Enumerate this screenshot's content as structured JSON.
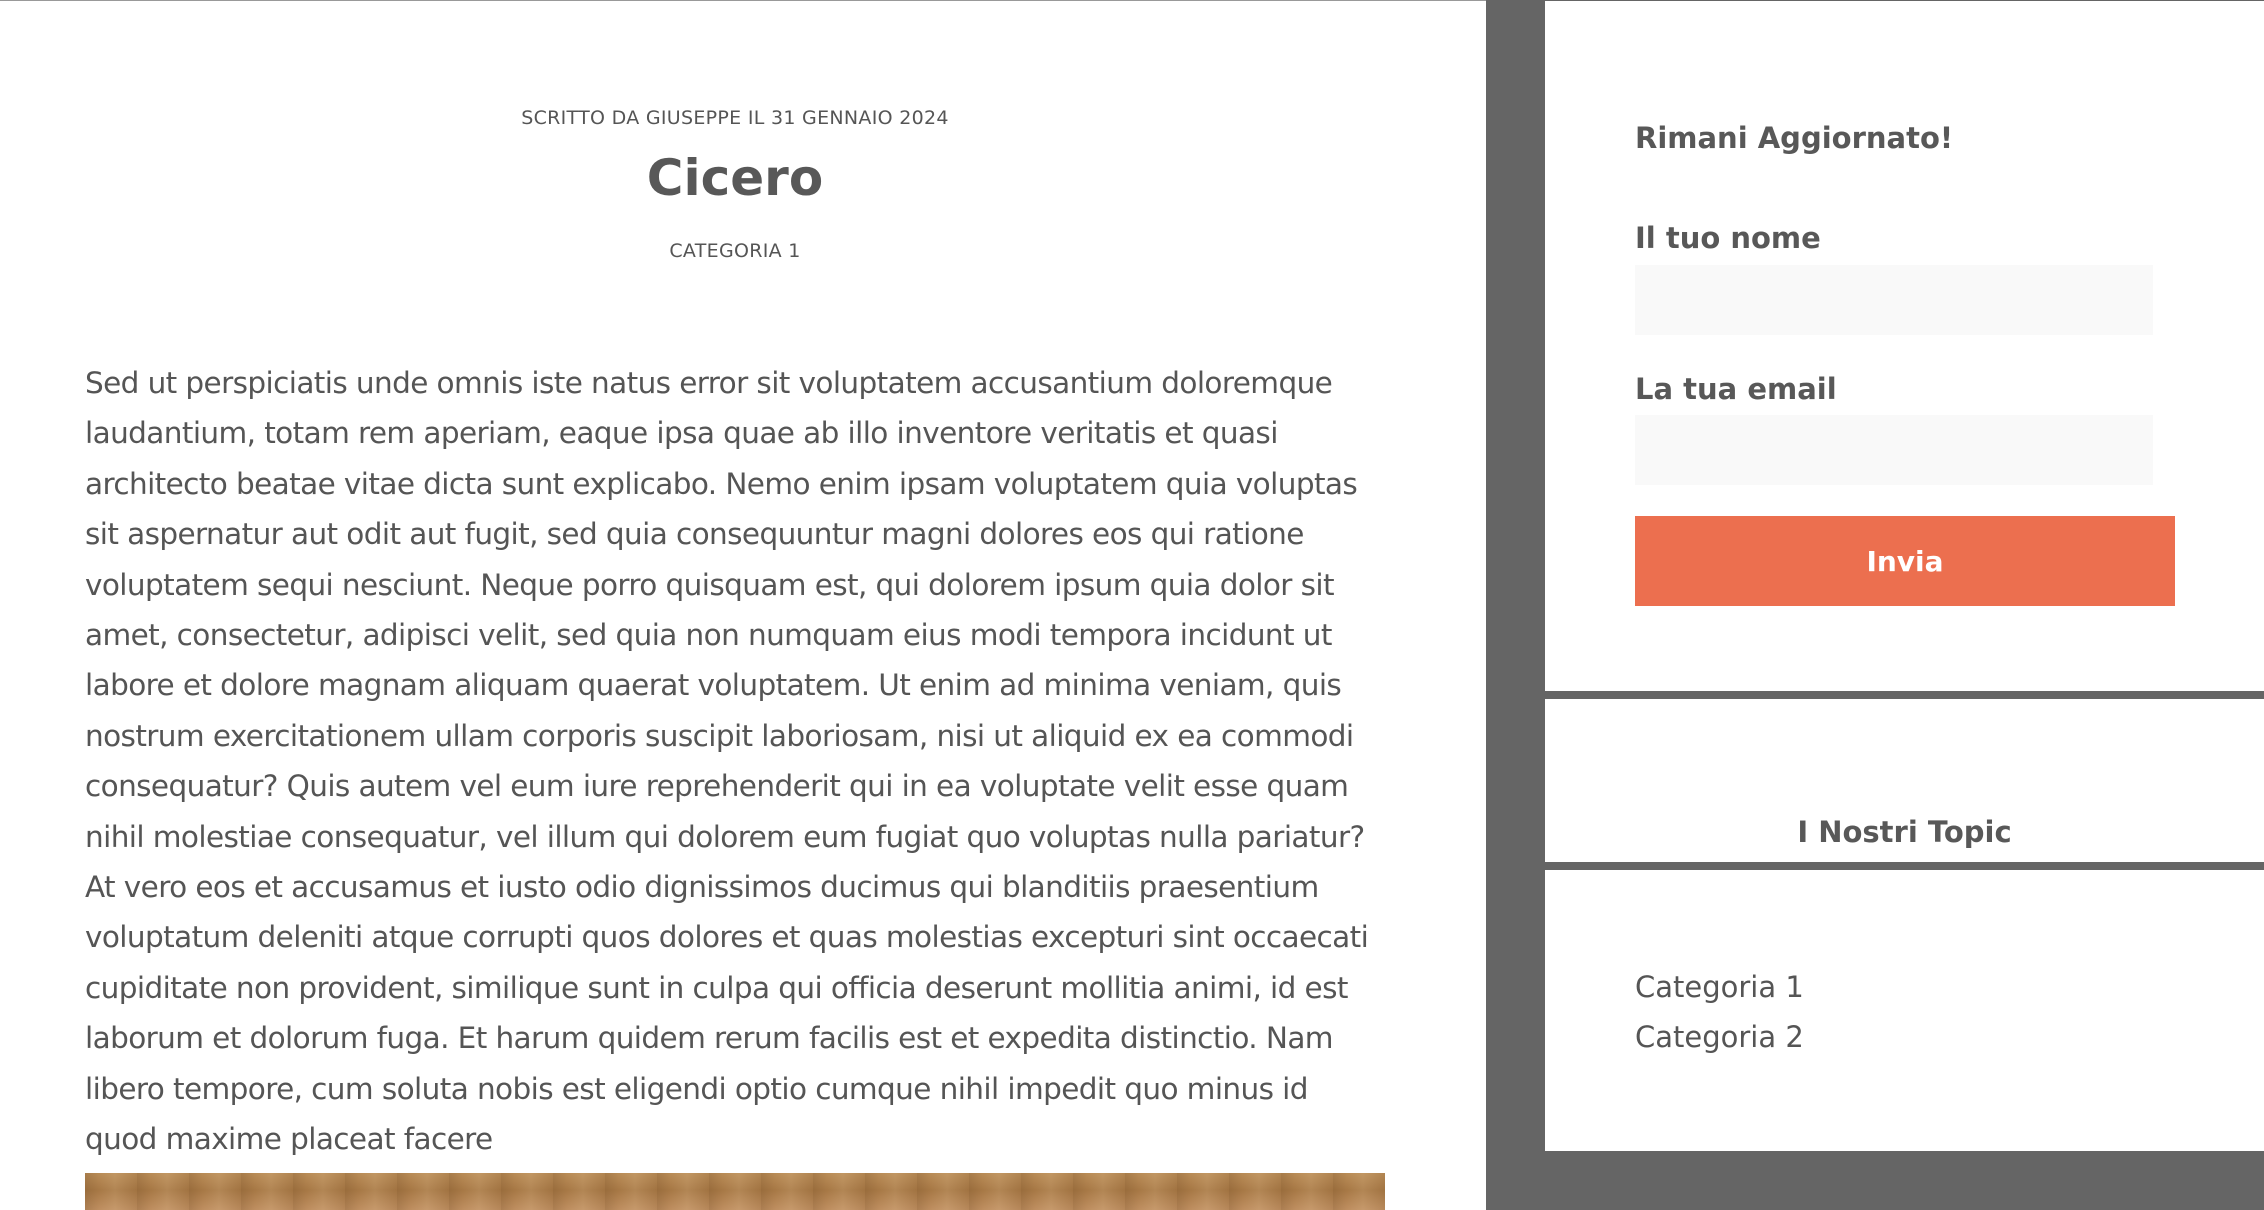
{
  "article": {
    "meta": "SCRITTO DA GIUSEPPE IL 31 GENNAIO 2024",
    "title": "Cicero",
    "category": "CATEGORIA 1",
    "body": "Sed ut perspiciatis unde omnis iste natus error sit voluptatem accusantium doloremque laudantium, totam rem aperiam, eaque ipsa quae ab illo inventore veritatis et quasi architecto beatae vitae dicta sunt explicabo. Nemo enim ipsam voluptatem quia voluptas sit aspernatur aut odit aut fugit, sed quia consequuntur magni dolores eos qui ratione voluptatem sequi nesciunt. Neque porro quisquam est, qui dolorem ipsum quia dolor sit amet, consectetur, adipisci velit, sed quia non numquam eius modi tempora incidunt ut labore et dolore magnam aliquam quaerat voluptatem. Ut enim ad minima veniam, quis nostrum exercitationem ullam corporis suscipit laboriosam, nisi ut aliquid ex ea commodi consequatur? Quis autem vel eum iure reprehenderit qui in ea voluptate velit esse quam nihil molestiae consequatur, vel illum qui dolorem eum fugiat quo voluptas nulla pariatur? At vero eos et accusamus et iusto odio dignissimos ducimus qui blanditiis praesentium voluptatum deleniti atque corrupti quos dolores et quas molestias excepturi sint occaecati cupiditate non provident, similique sunt in culpa qui officia deserunt mollitia animi, id est laborum et dolorum fuga. Et harum quidem rerum facilis est et expedita distinctio. Nam libero tempore, cum soluta nobis est eligendi optio cumque nihil impedit quo minus id quod maxime placeat facere"
  },
  "newsletter": {
    "heading": "Rimani Aggiornato!",
    "name_label": "Il tuo nome",
    "name_value": "",
    "email_label": "La tua email",
    "email_value": "",
    "submit_label": "Invia"
  },
  "topics": {
    "heading": "I Nostri Topic",
    "items": [
      "Categoria 1",
      "Categoria 2"
    ]
  },
  "colors": {
    "page_background": "#656565",
    "accent_button": "#ec6f4f",
    "text": "#555555"
  }
}
